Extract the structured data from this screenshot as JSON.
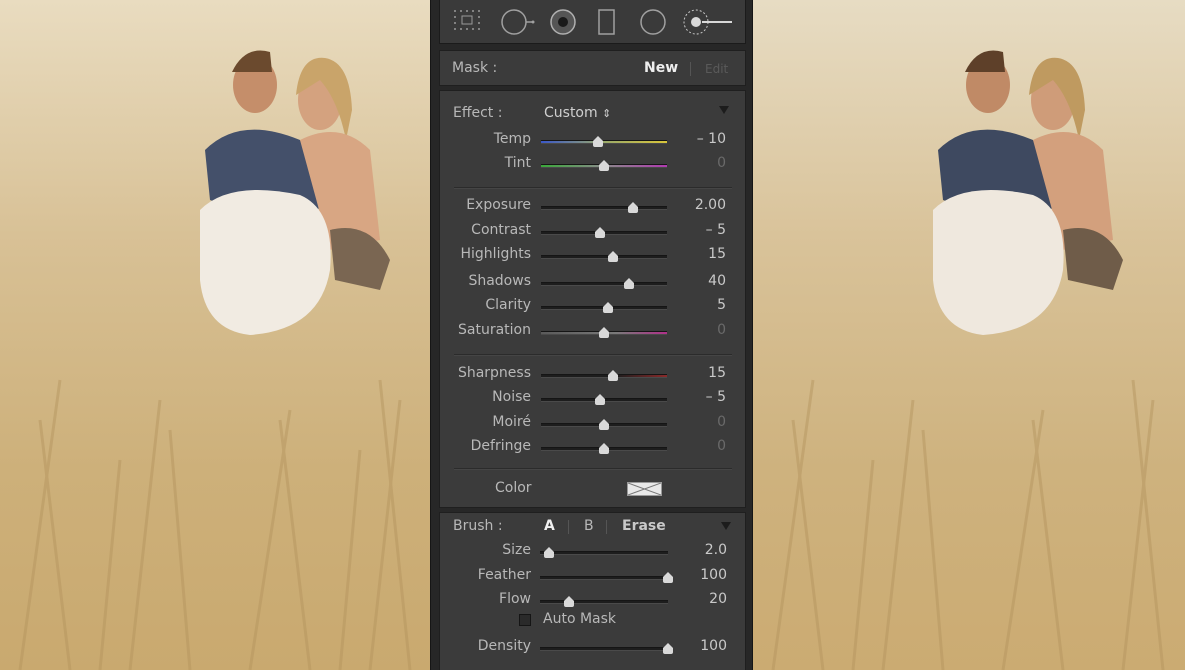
{
  "mask": {
    "label": "Mask :",
    "new_label": "New",
    "edit_label": "Edit"
  },
  "effect": {
    "label": "Effect :",
    "preset": "Custom",
    "preset_arrow": "⇕"
  },
  "color_group_1": [
    {
      "name": "Temp",
      "value": "– 10",
      "position": 0.45,
      "dim": false,
      "gradient": "temp"
    },
    {
      "name": "Tint",
      "value": "0",
      "position": 0.5,
      "dim": true,
      "gradient": "tint"
    }
  ],
  "tone_group": [
    {
      "name": "Exposure",
      "value": "2.00",
      "position": 0.73,
      "dim": false
    },
    {
      "name": "Contrast",
      "value": "– 5",
      "position": 0.47,
      "dim": false
    },
    {
      "name": "Highlights",
      "value": "15",
      "position": 0.57,
      "dim": false
    },
    {
      "name": "Shadows",
      "value": "40",
      "position": 0.7,
      "dim": false
    },
    {
      "name": "Clarity",
      "value": "5",
      "position": 0.53,
      "dim": false
    },
    {
      "name": "Saturation",
      "value": "0",
      "position": 0.5,
      "dim": true,
      "gradient": "sat"
    }
  ],
  "detail_group": [
    {
      "name": "Sharpness",
      "value": "15",
      "position": 0.57,
      "dim": false,
      "gradient": "sharp"
    },
    {
      "name": "Noise",
      "value": "– 5",
      "position": 0.47,
      "dim": false
    },
    {
      "name": "Moiré",
      "value": "0",
      "position": 0.5,
      "dim": true
    },
    {
      "name": "Defringe",
      "value": "0",
      "position": 0.5,
      "dim": true
    }
  ],
  "color": {
    "label": "Color"
  },
  "brush": {
    "label": "Brush :",
    "tab_a": "A",
    "tab_b": "B",
    "erase": "Erase",
    "size": {
      "name": "Size",
      "value": "2.0",
      "position": 0.07
    },
    "feather": {
      "name": "Feather",
      "value": "100",
      "position": 1.0
    },
    "flow": {
      "name": "Flow",
      "value": "20",
      "position": 0.23
    },
    "auto_mask": "Auto Mask",
    "density": {
      "name": "Density",
      "value": "100",
      "position": 1.0
    }
  },
  "tools": [
    "grid-overlay-icon",
    "spot-removal-icon",
    "red-eye-icon",
    "graduated-filter-icon",
    "radial-filter-icon",
    "adjustment-brush-icon"
  ],
  "colors": {
    "panel_bg": "#3b3b3b",
    "dark_bg": "#272727",
    "text": "#b8b8b8",
    "active_text": "#eeeeee"
  }
}
